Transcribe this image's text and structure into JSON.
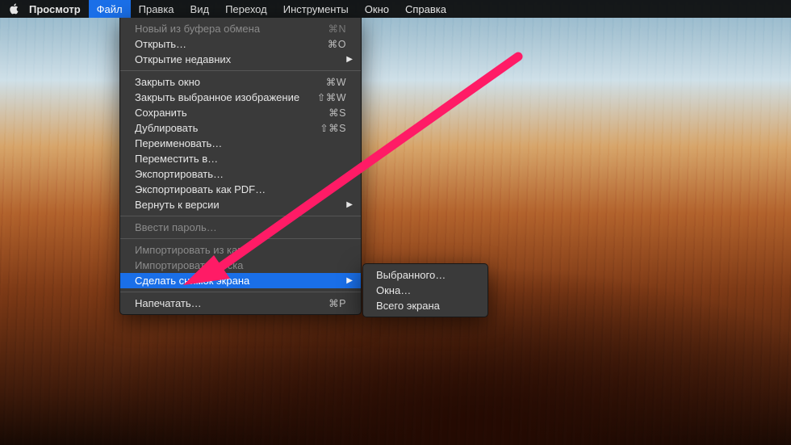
{
  "menubar": {
    "app_name": "Просмотр",
    "items": [
      "Файл",
      "Правка",
      "Вид",
      "Переход",
      "Инструменты",
      "Окно",
      "Справка"
    ],
    "active_index": 0
  },
  "dropdown": {
    "groups": [
      [
        {
          "label": "Новый из буфера обмена",
          "shortcut": "⌘N",
          "disabled": true
        },
        {
          "label": "Открыть…",
          "shortcut": "⌘O"
        },
        {
          "label": "Открытие недавних",
          "submenu": true
        }
      ],
      [
        {
          "label": "Закрыть окно",
          "shortcut": "⌘W"
        },
        {
          "label": "Закрыть выбранное изображение",
          "shortcut": "⇧⌘W"
        },
        {
          "label": "Сохранить",
          "shortcut": "⌘S"
        },
        {
          "label": "Дублировать",
          "shortcut": "⇧⌘S"
        },
        {
          "label": "Переименовать…"
        },
        {
          "label": "Переместить в…"
        },
        {
          "label": "Экспортировать…"
        },
        {
          "label": "Экспортировать как PDF…"
        },
        {
          "label": "Вернуть к версии",
          "submenu": true
        }
      ],
      [
        {
          "label": "Ввести пароль…",
          "disabled": true
        }
      ],
      [
        {
          "label": "Импортировать из кам",
          "disabled": true
        },
        {
          "label": "Импортировать со ска",
          "disabled": true
        },
        {
          "label": "Сделать снимок экрана",
          "submenu": true,
          "highlight": true
        }
      ],
      [
        {
          "label": "Напечатать…",
          "shortcut": "⌘P"
        }
      ]
    ]
  },
  "submenu": {
    "items": [
      {
        "label": "Выбранного…"
      },
      {
        "label": "Окна…"
      },
      {
        "label": "Всего экрана"
      }
    ]
  },
  "annotation": {
    "color": "#ff1b66"
  }
}
